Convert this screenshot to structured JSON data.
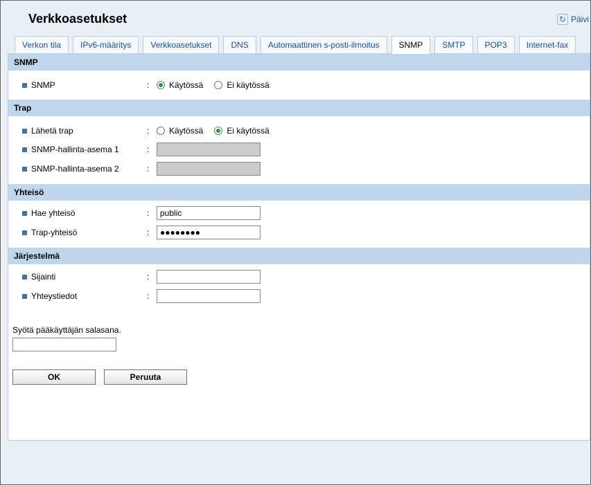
{
  "header": {
    "title": "Verkkoasetukset",
    "refresh_label": "Päivi"
  },
  "tabs": [
    {
      "label": "Verkon tila"
    },
    {
      "label": "IPv6-määritys"
    },
    {
      "label": "Verkkoasetukset"
    },
    {
      "label": "DNS"
    },
    {
      "label": "Automaattinen s-posti-ilmoitus"
    },
    {
      "label": "SNMP"
    },
    {
      "label": "SMTP"
    },
    {
      "label": "POP3"
    },
    {
      "label": "Internet-fax"
    }
  ],
  "sec_snmp": {
    "title": "SNMP",
    "label_snmp": "SNMP",
    "opt_on": "Käytössä",
    "opt_off": "Ei käytössä"
  },
  "sec_trap": {
    "title": "Trap",
    "label_send": "Lähetä trap",
    "opt_on": "Käytössä",
    "opt_off": "Ei käytössä",
    "label_station1": "SNMP-hallinta-asema 1",
    "label_station2": "SNMP-hallinta-asema 2",
    "val_station1": "",
    "val_station2": ""
  },
  "sec_comm": {
    "title": "Yhteisö",
    "label_get": "Hae yhteisö",
    "val_get": "public",
    "label_trap": "Trap-yhteisö",
    "val_trap": "●●●●●●●●"
  },
  "sec_sys": {
    "title": "Järjestelmä",
    "label_loc": "Sijainti",
    "val_loc": "",
    "label_contact": "Yhteystiedot",
    "val_contact": ""
  },
  "footer": {
    "pw_prompt": "Syötä pääkäyttäjän salasana.",
    "pw_value": "",
    "btn_ok": "OK",
    "btn_cancel": "Peruuta"
  }
}
